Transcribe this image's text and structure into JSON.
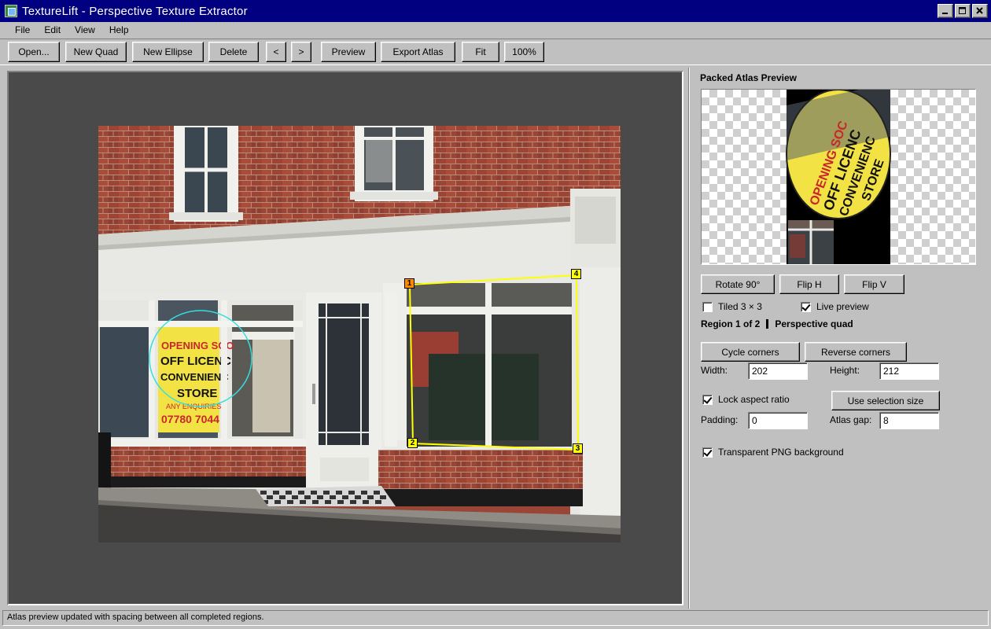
{
  "window": {
    "title": "TextureLift - Perspective Texture Extractor"
  },
  "menu": [
    "File",
    "Edit",
    "View",
    "Help"
  ],
  "toolbar": {
    "open": "Open...",
    "new_quad": "New Quad",
    "new_ellipse": "New Ellipse",
    "delete": "Delete",
    "prev": "<",
    "next": ">",
    "preview": "Preview",
    "export_atlas": "Export Atlas",
    "fit": "Fit",
    "zoom": "100%"
  },
  "canvas": {
    "sign_lines": [
      "OPENING SOO",
      "OFF LICENC",
      "CONVENIENC",
      "STORE",
      "ANY ENQUIRIES",
      "07780 7044"
    ],
    "quad_corners": [
      "1",
      "2",
      "3",
      "4"
    ],
    "colors": {
      "quad": "#ffff00",
      "ellipse": "#33e0e0",
      "corner_active": "#ff8a00"
    }
  },
  "panel": {
    "atlas_title": "Packed Atlas Preview",
    "rotate": "Rotate 90°",
    "flip_h": "Flip H",
    "flip_v": "Flip V",
    "tiled_label": "Tiled 3 × 3",
    "tiled_checked": false,
    "live_preview_label": "Live preview",
    "live_preview_checked": true,
    "region_index": "Region 1 of 2",
    "region_type": "Perspective quad",
    "cycle_corners": "Cycle corners",
    "reverse_corners": "Reverse corners",
    "width_label": "Width:",
    "width_value": "202",
    "height_label": "Height:",
    "height_value": "212",
    "lock_aspect_label": "Lock aspect ratio",
    "lock_aspect_checked": true,
    "use_selection_size": "Use selection size",
    "padding_label": "Padding:",
    "padding_value": "0",
    "atlas_gap_label": "Atlas gap:",
    "atlas_gap_value": "8",
    "transparent_png_label": "Transparent PNG background",
    "transparent_png_checked": true
  },
  "status": {
    "message": "Atlas preview updated with spacing between all completed regions."
  }
}
